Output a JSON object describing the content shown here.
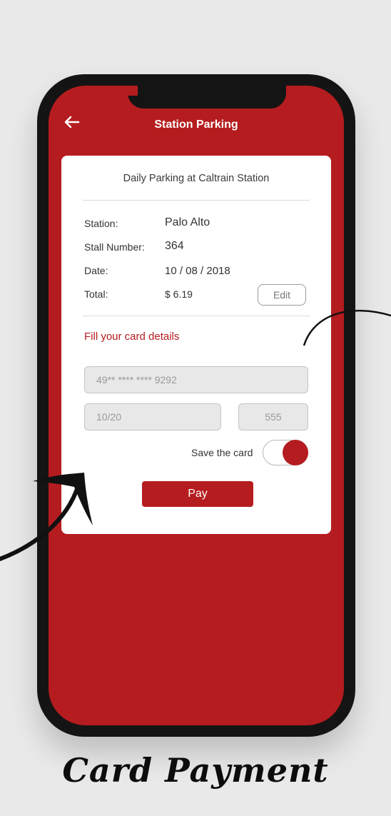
{
  "header": {
    "title": "Station Parking"
  },
  "booking": {
    "subtitle": "Daily Parking at Caltrain Station",
    "station_label": "Station:",
    "station_value": "Palo Alto",
    "stall_label": "Stall Number:",
    "stall_value": "364",
    "date_label": "Date:",
    "date_value": "10 / 08 / 2018",
    "total_label": "Total:",
    "total_value": "$ 6.19",
    "edit_label": "Edit"
  },
  "payment": {
    "section_title": "Fill your card details",
    "card_number_placeholder": "49** **** **** 9292",
    "expiry_placeholder": "10/20",
    "cvv_placeholder": "555",
    "save_card_label": "Save the card",
    "save_card_on": true,
    "pay_label": "Pay"
  },
  "caption": "Card Payment",
  "colors": {
    "accent": "#b51c1f",
    "frame": "#141414",
    "background": "#e9e9ea"
  }
}
